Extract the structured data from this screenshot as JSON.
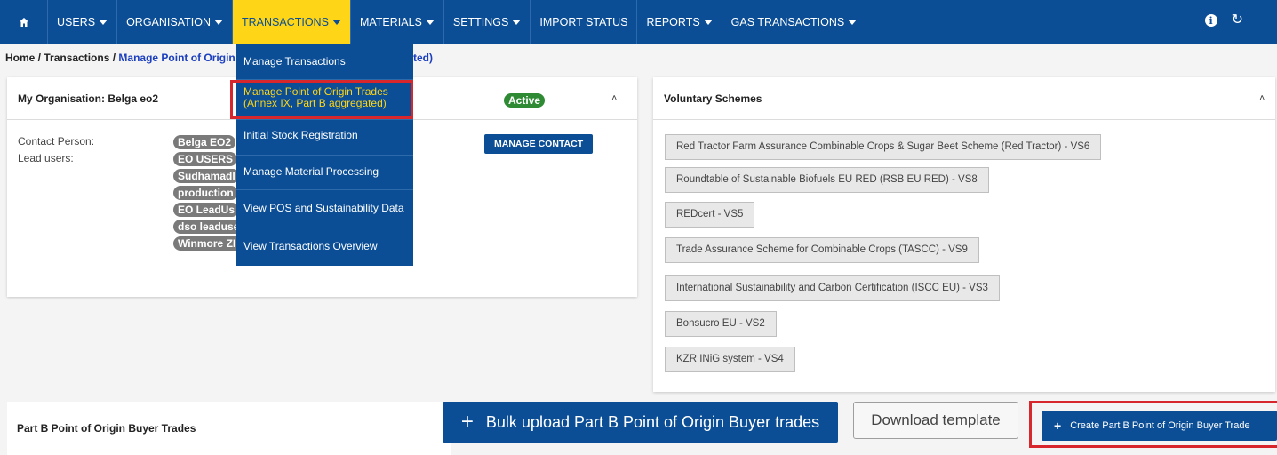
{
  "nav": {
    "items": [
      {
        "label": "USERS",
        "caret": true
      },
      {
        "label": "ORGANISATION",
        "caret": true
      },
      {
        "label": "TRANSACTIONS",
        "caret": true,
        "active": true
      },
      {
        "label": "MATERIALS",
        "caret": true
      },
      {
        "label": "SETTINGS",
        "caret": true
      },
      {
        "label": "IMPORT STATUS",
        "caret": false
      },
      {
        "label": "REPORTS",
        "caret": true
      },
      {
        "label": "GAS TRANSACTIONS",
        "caret": true
      }
    ],
    "home_icon": "home-icon",
    "right_icons": [
      "info-icon",
      "logout-icon"
    ]
  },
  "breadcrumb": {
    "home": "Home",
    "sep": " / ",
    "section": "Transactions",
    "current_visible_start": "Manage Point of Origin",
    "current_visible_end": "ted)"
  },
  "dropdown": {
    "items": [
      "Manage Transactions",
      "Manage Point of Origin Trades (Annex IX, Part B aggregated)",
      "Initial Stock Registration",
      "Manage Material Processing",
      "View POS and Sustainability Data",
      "View Transactions Overview"
    ]
  },
  "organisation": {
    "title": "My Organisation: Belga eo2",
    "status": "Active",
    "contact_label": "Contact Person:",
    "lead_label": "Lead users:",
    "contact_person": "Belga EO2",
    "lead_users": [
      "EO USERS",
      "Sudhamadl",
      "production",
      "EO LeadUs",
      "dso leaduse",
      "Winmore ZIMMERMANN"
    ],
    "manage_contact_label": "MANAGE CONTACT"
  },
  "voluntary_schemes": {
    "title": "Voluntary Schemes",
    "items": [
      "Red Tractor Farm Assurance Combinable Crops & Sugar Beet Scheme (Red Tractor) - VS6",
      "Roundtable of Sustainable Biofuels EU RED (RSB EU RED) - VS8",
      "REDcert - VS5",
      "Trade Assurance Scheme for Combinable Crops (TASCC) - VS9",
      "International Sustainability and Carbon Certification (ISCC EU) - VS3",
      "Bonsucro EU - VS2",
      "KZR INiG system - VS4"
    ]
  },
  "partb": {
    "title": "Part B Point of Origin Buyer Trades",
    "bulk_upload_label": "Bulk upload Part B Point of Origin Buyer trades",
    "download_template_label": "Download template",
    "create_label": "Create Part B Point of Origin Buyer Trade"
  },
  "colors": {
    "primary": "#0b4e96",
    "accent": "#ffd617",
    "active_badge": "#2e8b34",
    "highlight": "#d7262c"
  }
}
